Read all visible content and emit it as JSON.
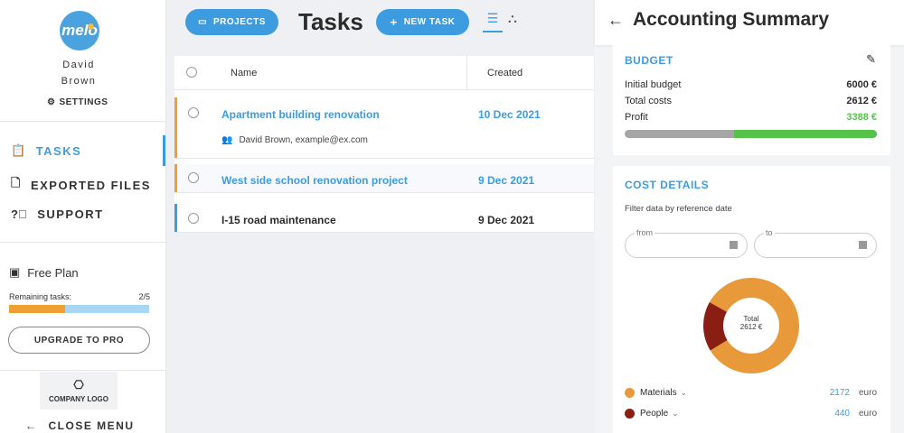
{
  "sidebar": {
    "logo_text": "melo",
    "user_first": "David",
    "user_last": "Brown",
    "settings_label": "SETTINGS",
    "nav": [
      {
        "label": "TASKS",
        "icon": "clipboard-icon",
        "active": true
      },
      {
        "label": "EXPORTED FILES",
        "icon": "file-icon",
        "active": false
      },
      {
        "label": "SUPPORT",
        "icon": "question-icon",
        "active": false
      }
    ],
    "plan_label": "Free Plan",
    "remaining_label": "Remaining tasks:",
    "remaining_value": "2/5",
    "remaining_fraction": 0.4,
    "upgrade_label": "UPGRADE TO PRO",
    "company_logo_label": "COMPANY LOGO",
    "close_label": "CLOSE MENU"
  },
  "toolbar": {
    "projects_label": "PROJECTS",
    "page_title": "Tasks",
    "new_task_label": "NEW TASK"
  },
  "table": {
    "headers": {
      "name": "Name",
      "created": "Created"
    },
    "rows": [
      {
        "name": "Apartment building renovation",
        "created": "10 Dec 2021",
        "assignee": "David Brown, example@ex.com",
        "accent": "#f0a033",
        "color": "#3d9be0"
      },
      {
        "name": "West side school renovation project",
        "created": "9 Dec 2021",
        "accent": "#f0a033",
        "color": "#3d9be0"
      },
      {
        "name": "I-15 road maintenance",
        "created": "9 Dec 2021",
        "accent": "#3d9be0",
        "color": "#2b2b2b"
      }
    ]
  },
  "panel": {
    "title": "Accounting Summary",
    "budget": {
      "title": "BUDGET",
      "initial_label": "Initial budget",
      "initial_value": "6000 €",
      "costs_label": "Total costs",
      "costs_value": "2612 €",
      "profit_label": "Profit",
      "profit_value": "3388 €",
      "profit_fraction": 0.565
    },
    "cost_details": {
      "title": "COST DETAILS",
      "filter_label": "Filter data by reference date",
      "from_label": "from",
      "to_label": "to",
      "donut_label": "Total",
      "donut_value": "2612 €",
      "items": [
        {
          "name": "Materials",
          "value": "2172",
          "unit": "euro",
          "color": "#e8993a"
        },
        {
          "name": "People",
          "value": "440",
          "unit": "euro",
          "color": "#8b1e12"
        }
      ]
    }
  },
  "colors": {
    "accent": "#3d9be0",
    "orange": "#f0a033",
    "green": "#55c24a"
  }
}
